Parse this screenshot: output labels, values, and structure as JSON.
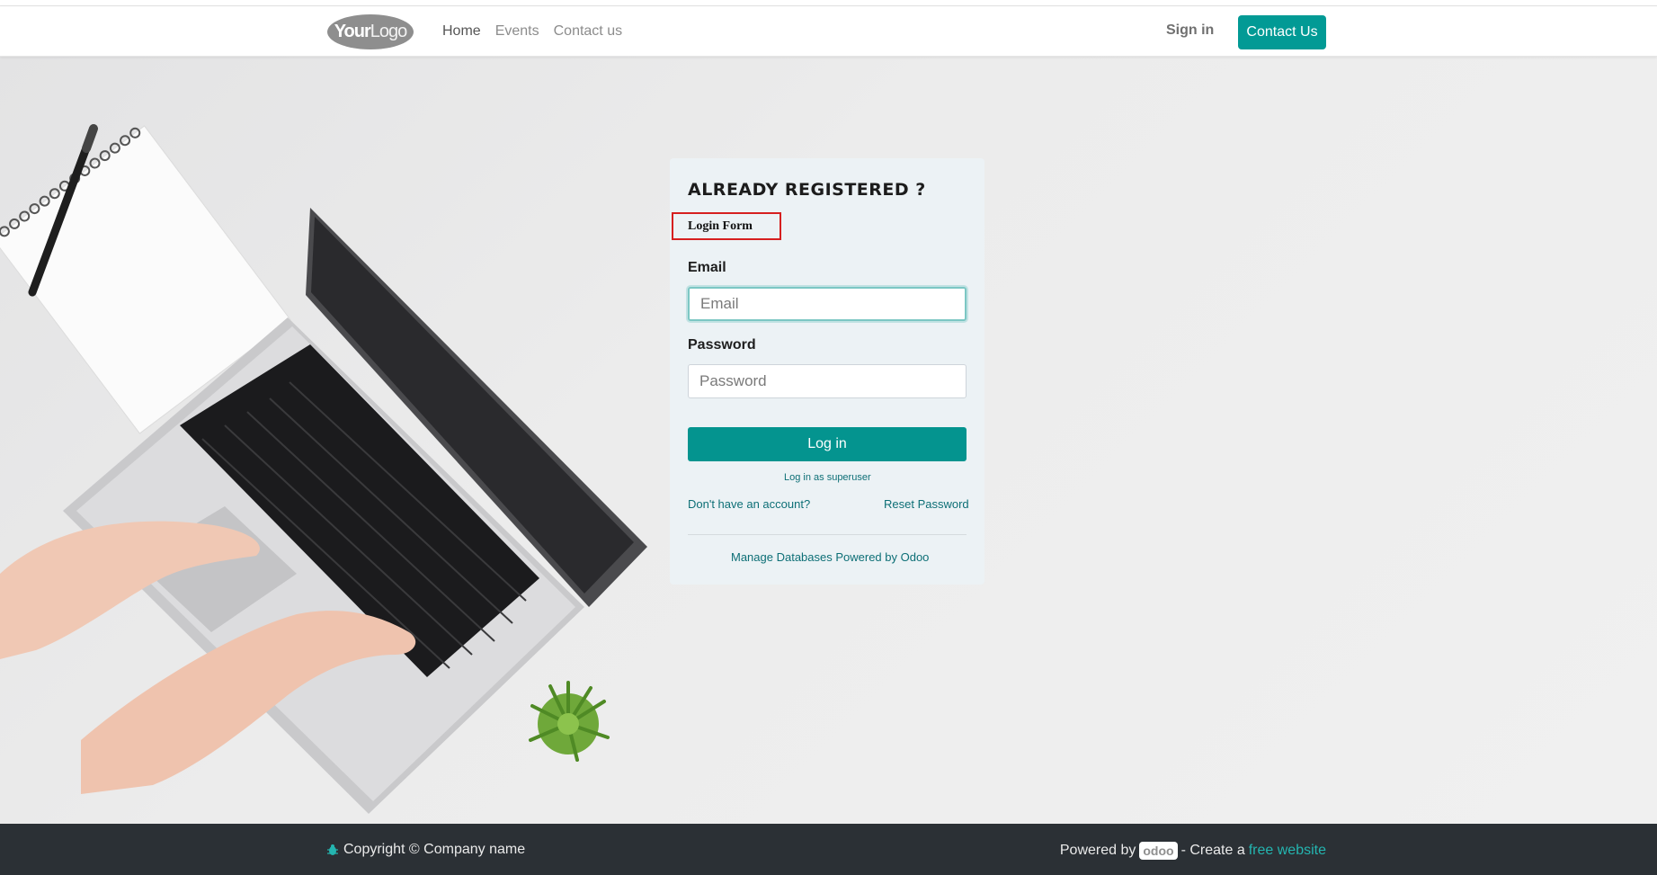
{
  "header": {
    "logo": {
      "bold": "Your",
      "light": "Logo"
    },
    "nav": [
      {
        "label": "Home"
      },
      {
        "label": "Events"
      },
      {
        "label": "Contact us"
      }
    ],
    "signin_label": "Sign in",
    "cta_label": "Contact Us"
  },
  "card": {
    "title": "ALREADY REGISTERED ?",
    "form_tag": "Login Form",
    "email_label": "Email",
    "email_placeholder": "Email",
    "password_label": "Password",
    "password_placeholder": "Password",
    "login_button": "Log in",
    "superuser_link": "Log in as superuser",
    "signup_link": "Don't have an account?",
    "reset_link": "Reset Password",
    "manage_link": "Manage Databases Powered by Odoo"
  },
  "footer": {
    "copyright": "Copyright © Company name",
    "powered_by": "Powered by",
    "odoo": "odoo",
    "create": "- Create a",
    "free_website": "free website"
  },
  "colors": {
    "primary": "#029a95",
    "footer_bg": "#2b3035",
    "link": "#0d6f76",
    "highlight_box": "#d61f1f"
  }
}
